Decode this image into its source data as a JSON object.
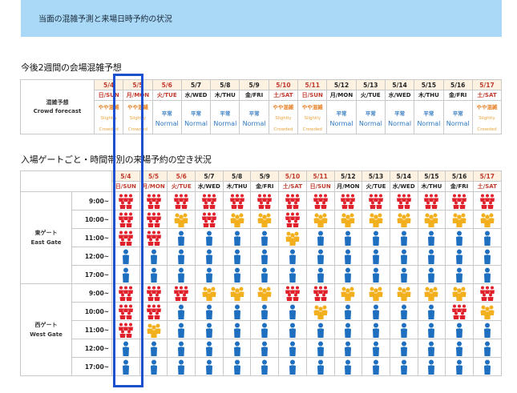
{
  "banner": {
    "text": "当面の混雑予測と来場日時予約の状況"
  },
  "sections": {
    "forecast_title": "今後2週間の会場混雑予想",
    "slots_title": "入場ゲートごと・時間帯別の来場予約の空き状況"
  },
  "forecast": {
    "row_label_ja": "混雑予想",
    "row_label_en": "Crowd forecast"
  },
  "dates": [
    {
      "date": "5/4",
      "day": "日/SUN",
      "weekend": true
    },
    {
      "date": "5/5",
      "day": "月/MON",
      "weekend": true
    },
    {
      "date": "5/6",
      "day": "火/TUE",
      "weekend": true
    },
    {
      "date": "5/7",
      "day": "水/WED",
      "weekend": false
    },
    {
      "date": "5/8",
      "day": "木/THU",
      "weekend": false
    },
    {
      "date": "5/9",
      "day": "金/FRI",
      "weekend": false
    },
    {
      "date": "5/10",
      "day": "土/SAT",
      "weekend": true
    },
    {
      "date": "5/11",
      "day": "日/SUN",
      "weekend": true
    },
    {
      "date": "5/12",
      "day": "月/MON",
      "weekend": false
    },
    {
      "date": "5/13",
      "day": "火/TUE",
      "weekend": false
    },
    {
      "date": "5/14",
      "day": "水/WED",
      "weekend": false
    },
    {
      "date": "5/15",
      "day": "木/THU",
      "weekend": false
    },
    {
      "date": "5/16",
      "day": "金/FRI",
      "weekend": false
    },
    {
      "date": "5/17",
      "day": "土/SAT",
      "weekend": true
    }
  ],
  "forecast_values": [
    {
      "ja": "やや混雑",
      "en": "Slightly Crowded",
      "level": "busy"
    },
    {
      "ja": "やや混雑",
      "en": "Slightly Crowded",
      "level": "busy"
    },
    {
      "ja": "平常",
      "en": "Normal",
      "level": "normal"
    },
    {
      "ja": "平常",
      "en": "Normal",
      "level": "normal"
    },
    {
      "ja": "平常",
      "en": "Normal",
      "level": "normal"
    },
    {
      "ja": "平常",
      "en": "Normal",
      "level": "normal"
    },
    {
      "ja": "やや混雑",
      "en": "Slightly Crowded",
      "level": "busy"
    },
    {
      "ja": "やや混雑",
      "en": "Slightly Crowded",
      "level": "busy"
    },
    {
      "ja": "平常",
      "en": "Normal",
      "level": "normal"
    },
    {
      "ja": "平常",
      "en": "Normal",
      "level": "normal"
    },
    {
      "ja": "平常",
      "en": "Normal",
      "level": "normal"
    },
    {
      "ja": "平常",
      "en": "Normal",
      "level": "normal"
    },
    {
      "ja": "平常",
      "en": "Normal",
      "level": "normal"
    },
    {
      "ja": "やや混雑",
      "en": "Slightly Crowded",
      "level": "busy"
    }
  ],
  "gates": [
    {
      "name_ja": "東ゲート",
      "name_en": "East Gate",
      "times": [
        "9:00~",
        "10:00~",
        "11:00~",
        "12:00~",
        "17:00~"
      ],
      "status": [
        [
          "full",
          "full",
          "full",
          "full",
          "full",
          "full",
          "full",
          "full",
          "full",
          "full",
          "full",
          "full",
          "full",
          "full"
        ],
        [
          "full",
          "full",
          "few",
          "full",
          "few",
          "few",
          "full",
          "few",
          "few",
          "few",
          "few",
          "few",
          "few",
          "few"
        ],
        [
          "full",
          "full",
          "open",
          "open",
          "open",
          "open",
          "few",
          "open",
          "open",
          "open",
          "open",
          "open",
          "open",
          "open"
        ],
        [
          "open",
          "open",
          "open",
          "open",
          "open",
          "open",
          "open",
          "open",
          "open",
          "open",
          "open",
          "open",
          "open",
          "open"
        ],
        [
          "open",
          "open",
          "open",
          "open",
          "open",
          "open",
          "open",
          "open",
          "open",
          "open",
          "open",
          "open",
          "open",
          "open"
        ]
      ]
    },
    {
      "name_ja": "西ゲート",
      "name_en": "West Gate",
      "times": [
        "9:00~",
        "10:00~",
        "11:00~",
        "12:00~",
        "17:00~"
      ],
      "status": [
        [
          "full",
          "full",
          "full",
          "few",
          "few",
          "few",
          "full",
          "full",
          "few",
          "few",
          "few",
          "few",
          "few",
          "full"
        ],
        [
          "full",
          "full",
          "open",
          "open",
          "open",
          "open",
          "open",
          "few",
          "open",
          "open",
          "open",
          "open",
          "full",
          "few"
        ],
        [
          "full",
          "few",
          "open",
          "open",
          "open",
          "open",
          "open",
          "open",
          "open",
          "open",
          "open",
          "open",
          "open",
          "open"
        ],
        [
          "open",
          "open",
          "open",
          "open",
          "open",
          "open",
          "open",
          "open",
          "open",
          "open",
          "open",
          "open",
          "open",
          "open"
        ],
        [
          "open",
          "open",
          "open",
          "open",
          "open",
          "open",
          "open",
          "open",
          "open",
          "open",
          "open",
          "open",
          "open",
          "open"
        ]
      ]
    }
  ],
  "colors": {
    "full": "#e0212b",
    "few": "#f2b01e",
    "open": "#1f6fc1",
    "highlight": "#1d4fd1",
    "banner": "#a9d9f7"
  },
  "icons": {
    "full": "crowd-full-icon",
    "few": "crowd-few-icon",
    "open": "person-open-icon"
  }
}
